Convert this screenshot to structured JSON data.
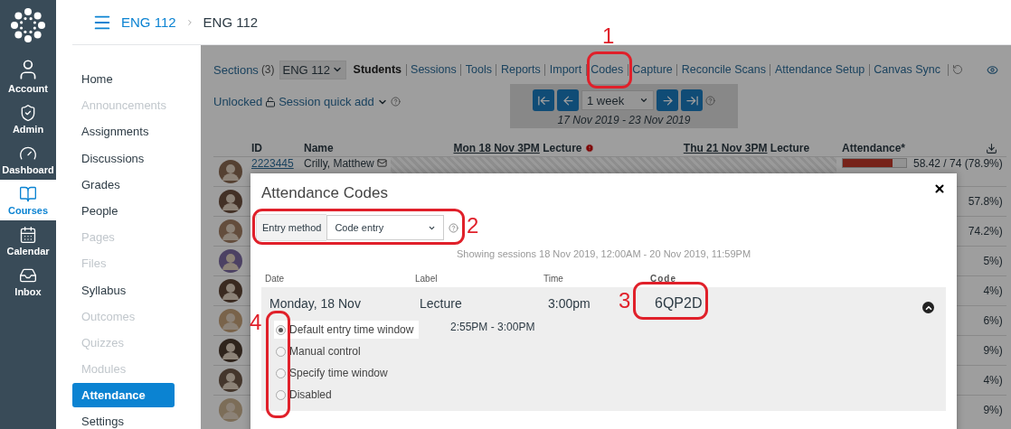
{
  "global_nav": [
    {
      "label": "Account",
      "selected": false
    },
    {
      "label": "Admin",
      "selected": false
    },
    {
      "label": "Dashboard",
      "selected": false
    },
    {
      "label": "Courses",
      "selected": true
    },
    {
      "label": "Calendar",
      "selected": false
    },
    {
      "label": "Inbox",
      "selected": false
    }
  ],
  "breadcrumb": [
    "ENG 112",
    "ENG 112"
  ],
  "course_nav": [
    {
      "label": "Home",
      "disabled": false,
      "selected": false
    },
    {
      "label": "Announcements",
      "disabled": true,
      "selected": false
    },
    {
      "label": "Assignments",
      "disabled": false,
      "selected": false
    },
    {
      "label": "Discussions",
      "disabled": false,
      "selected": false
    },
    {
      "label": "Grades",
      "disabled": false,
      "selected": false
    },
    {
      "label": "People",
      "disabled": false,
      "selected": false
    },
    {
      "label": "Pages",
      "disabled": true,
      "selected": false
    },
    {
      "label": "Files",
      "disabled": true,
      "selected": false
    },
    {
      "label": "Syllabus",
      "disabled": false,
      "selected": false
    },
    {
      "label": "Outcomes",
      "disabled": true,
      "selected": false
    },
    {
      "label": "Quizzes",
      "disabled": true,
      "selected": false
    },
    {
      "label": "Modules",
      "disabled": true,
      "selected": false
    },
    {
      "label": "Attendance",
      "disabled": false,
      "selected": true
    },
    {
      "label": "Settings",
      "disabled": false,
      "selected": false
    }
  ],
  "toolbar": {
    "sections": {
      "label": "Sections",
      "count": "(3)"
    },
    "section_select": "ENG 112",
    "tabs": [
      {
        "label": "Students",
        "selected": true
      },
      {
        "label": "Sessions",
        "selected": false
      },
      {
        "label": "Tools",
        "selected": false
      },
      {
        "label": "Reports",
        "selected": false
      },
      {
        "label": "Import",
        "selected": false
      },
      {
        "label": "Codes",
        "selected": false
      },
      {
        "label": "Capture",
        "selected": false
      },
      {
        "label": "Reconcile Scans",
        "selected": false
      },
      {
        "label": "Attendance Setup",
        "selected": false
      },
      {
        "label": "Canvas Sync",
        "selected": false
      }
    ]
  },
  "lock": {
    "label": "Unlocked",
    "locked": false
  },
  "quick_add": "Session quick add",
  "date_nav": {
    "range": "1 week",
    "dates": "17 Nov 2019 - 23 Nov 2019"
  },
  "table": {
    "columns": [
      {
        "kind": "plain",
        "label": "ID"
      },
      {
        "kind": "plain",
        "label": "Name"
      },
      {
        "kind": "session",
        "date": "Mon 18 Nov 3PM",
        "label": "Lecture",
        "warning": true
      },
      {
        "kind": "session",
        "date": "Thu 21 Nov 3PM",
        "label": "Lecture",
        "warning": false
      },
      {
        "kind": "plain",
        "label": "Attendance*"
      }
    ],
    "rows": [
      {
        "id": "2223445",
        "name": "Crilly, Matthew",
        "attendance": "58.42 / 74 (78.9%)",
        "level": 0.789
      },
      {
        "attendance": "57.8%)"
      },
      {
        "attendance": "74.2%)"
      },
      {
        "attendance": "5%)"
      },
      {
        "attendance": "4%)"
      },
      {
        "attendance": "6%)"
      },
      {
        "attendance": "9%)"
      },
      {
        "attendance": "4%)"
      },
      {
        "attendance": "9%)"
      }
    ]
  },
  "modal": {
    "title": "Attendance Codes",
    "entry_label": "Entry method",
    "entry_value": "Code entry",
    "range": "Showing sessions 18 Nov 2019, 12:00AM - 20 Nov 2019, 11:59PM",
    "columns": [
      "Date",
      "Label",
      "Time",
      "Code"
    ],
    "session": {
      "date": "Monday, 18 Nov",
      "label": "Lecture",
      "time": "3:00pm",
      "code": "6QP2D",
      "expanded": true,
      "window": "2:55PM - 3:00PM",
      "options": [
        {
          "label": "Default entry time window",
          "selected": true
        },
        {
          "label": "Manual control",
          "selected": false
        },
        {
          "label": "Specify time window",
          "selected": false
        },
        {
          "label": "Disabled",
          "selected": false
        }
      ]
    }
  },
  "annotations": [
    "1",
    "2",
    "3",
    "4"
  ]
}
